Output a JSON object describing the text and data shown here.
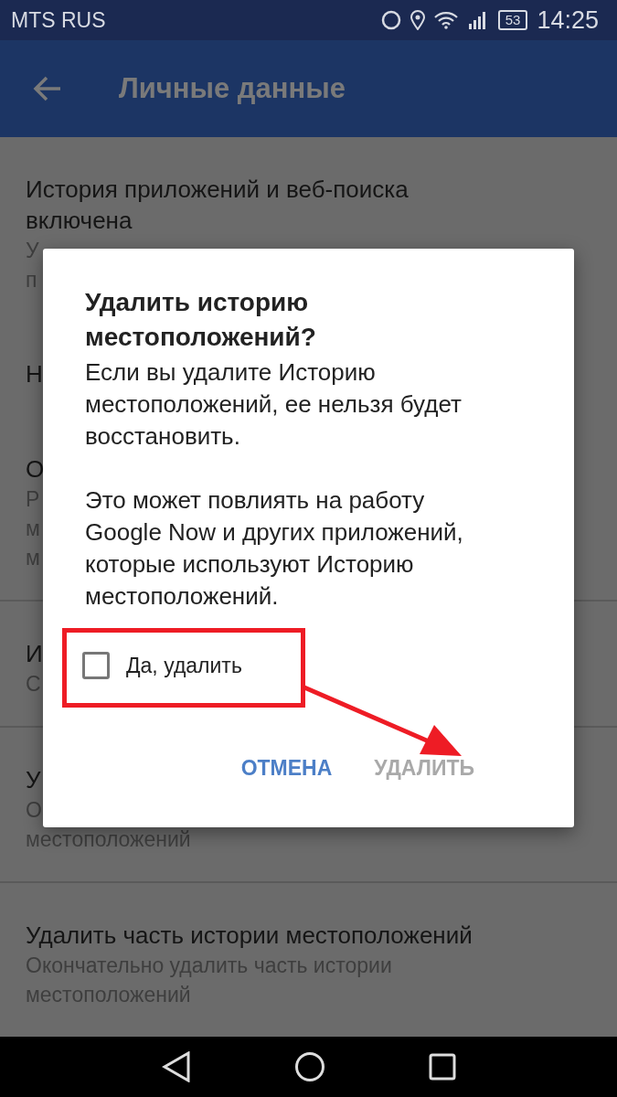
{
  "status_bar": {
    "carrier": "MTS RUS",
    "battery": "53",
    "time": "14:25"
  },
  "app_bar": {
    "title": "Личные данные"
  },
  "settings_items": [
    {
      "title": [
        "История приложений и веб-поиска",
        "включена"
      ],
      "subtitle": [
        "У",
        "п"
      ],
      "divider": false
    },
    {
      "title": [
        "Н"
      ],
      "divider": false
    },
    {
      "title": [
        "О"
      ],
      "subtitle": [
        "Р",
        "м",
        "м"
      ],
      "divider": true
    },
    {
      "title": [
        "И"
      ],
      "subtitle": [
        "С"
      ],
      "divider": true
    },
    {
      "title": [
        "У"
      ],
      "subtitle": [
        "О",
        "местоположений"
      ],
      "divider": true
    },
    {
      "title": [
        "Удалить часть истории местоположений"
      ],
      "subtitle": [
        "Окончательно удалить часть истории",
        "местоположений"
      ],
      "divider": false
    }
  ],
  "dialog": {
    "title": "Удалить историю местоположений?",
    "paragraphs": [
      "Если вы удалите Историю местоположений, ее нельзя будет восстановить.",
      "Это может повлиять на работу Google Now и других приложений, которые используют Историю местоположений."
    ],
    "checkbox": {
      "label": "Да, удалить",
      "checked": false
    },
    "buttons": [
      {
        "label": "ОТМЕНА",
        "disabled": false
      },
      {
        "label": "УДАЛИТЬ",
        "disabled": true
      }
    ]
  }
}
